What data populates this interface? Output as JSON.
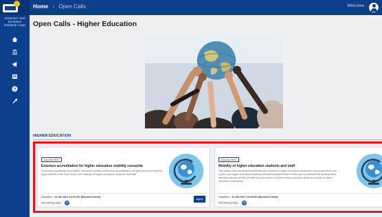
{
  "header": {
    "breadcrumb_home": "Home",
    "breadcrumb_sep": "›",
    "breadcrumb_current": "Open Calls",
    "welcome": "Welcome"
  },
  "sidebar": {
    "title": "Erasmus+ and European Solidarity Corps",
    "icons": [
      "home-icon",
      "institution-icon",
      "megaphone-icon",
      "list-icon",
      "help-icon",
      "tools-icon"
    ]
  },
  "main": {
    "page_title": "Open Calls - Higher Education",
    "section_label": "HIGHER EDUCATION"
  },
  "calls": [
    {
      "tag": "KA130-HED",
      "title": "Erasmus accreditation for higher education mobility consortia",
      "description": "Successful applicants for a higher education mobility consortium accreditation will gain access to funding opportunities in the Key Action 1 for mobility of higher education students and staff.",
      "deadline_label": "Deadline :",
      "deadline": "11-05-2021 12:00:00 (Brussels time)",
      "remaining_label": "Remaining days :",
      "remaining": "20",
      "apply": "Apply"
    },
    {
      "tag": "KA131-HED",
      "title": "Mobility of higher education students and staff",
      "description": "This action supports physical and blended mobility of higher education students in any study fields and cycles and higher education teaching and administrative staff to take part in professional development activities abroad as well as staff from the world of work to teach and train students or staff at higher education institutions.",
      "deadline_label": "Deadline :",
      "deadline": "11-05-2021 12:00:00 (Brussels time)",
      "remaining_label": "Remaining days :",
      "remaining": "20"
    }
  ],
  "colors": {
    "brand": "#0d3e8c",
    "highlight": "#e3161b",
    "globe": "#7cc6ee"
  }
}
